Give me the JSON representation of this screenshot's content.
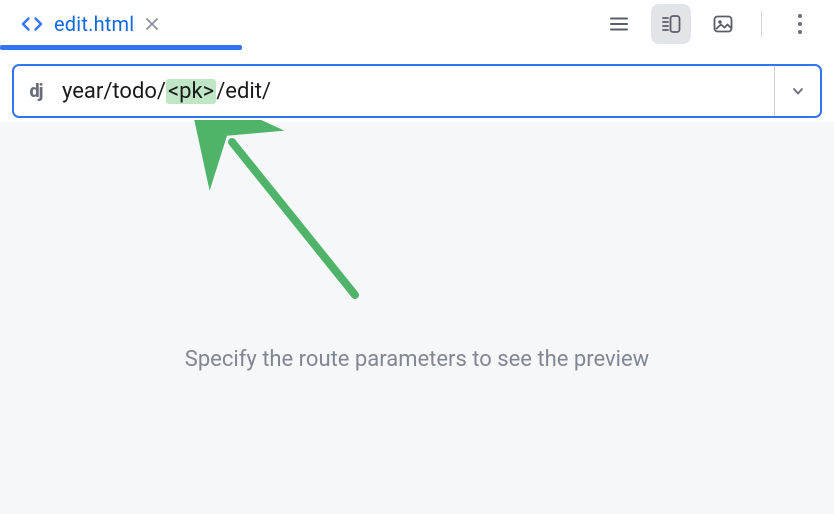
{
  "tab": {
    "filename": "edit.html"
  },
  "route": {
    "prefix": "year/todo/",
    "param": "<pk>",
    "suffix": "/edit/"
  },
  "preview": {
    "message": "Specify the route parameters to see the preview"
  },
  "icons": {
    "code": "code-icon",
    "close": "close-icon",
    "list": "list-view-icon",
    "split": "split-view-icon",
    "image": "image-view-icon",
    "more": "kebab-menu-icon",
    "dj": "django-icon",
    "caret": "chevron-down-icon"
  },
  "colors": {
    "accent": "#3574f0",
    "tabText": "#1169df",
    "paramBg": "#bfe7c6",
    "arrow": "#4fb36a"
  }
}
